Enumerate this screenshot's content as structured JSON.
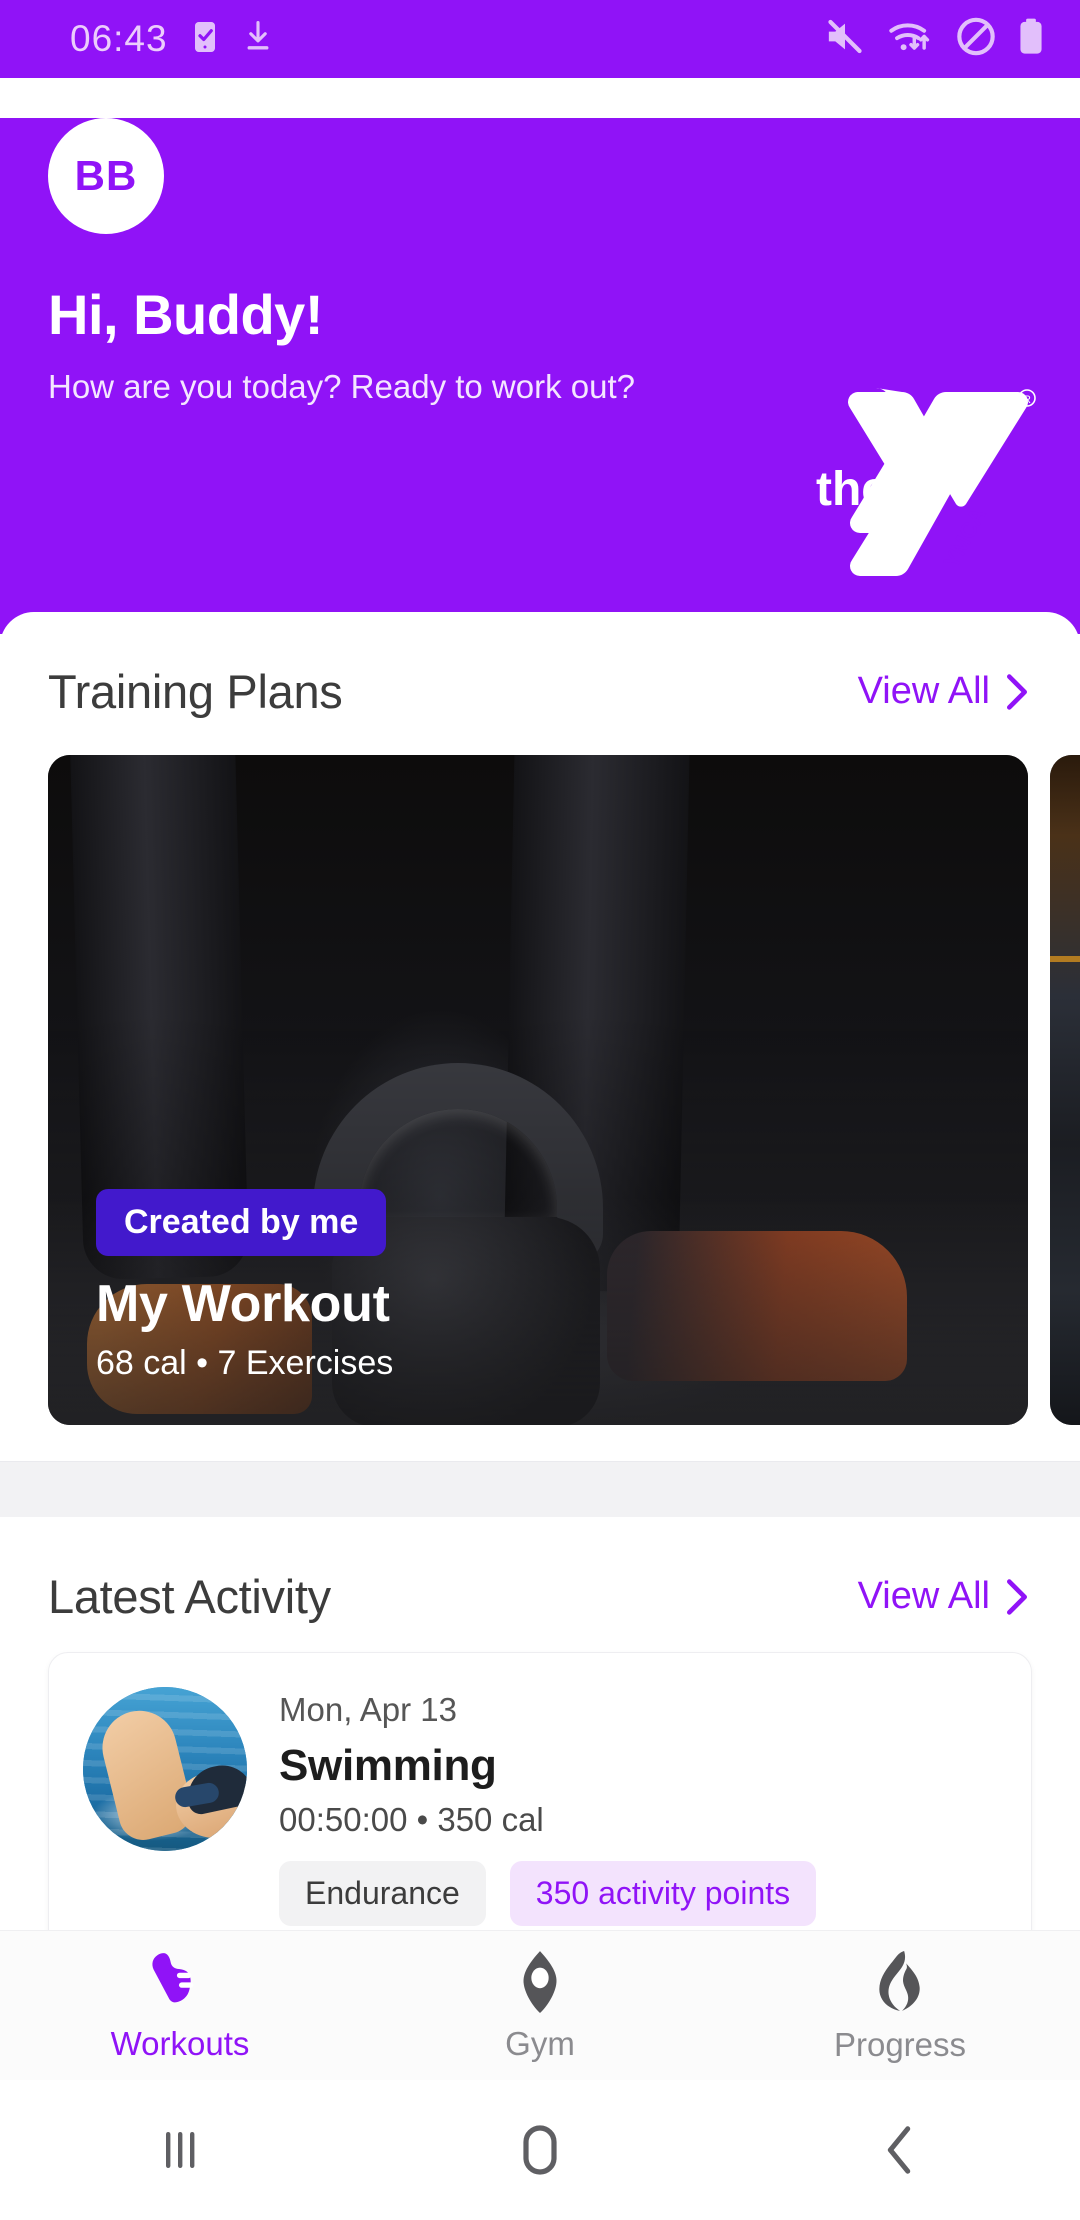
{
  "status_bar": {
    "time": "06:43",
    "left_icons": [
      "sim-card-check-icon",
      "download-icon"
    ],
    "right_icons": [
      "mute-icon",
      "wifi-transfer-icon",
      "do-not-disturb-icon",
      "battery-icon"
    ]
  },
  "header": {
    "avatar_initials": "BB",
    "greeting": "Hi, Buddy!",
    "subtitle": "How are you today? Ready to work out?",
    "logo": {
      "the_text": "the",
      "ymca_text": "YMCA",
      "registered_mark": "®"
    },
    "background_color": "#9013f7"
  },
  "training_plans": {
    "section_title": "Training Plans",
    "view_all_label": "View All",
    "cards": [
      {
        "badge": "Created by me",
        "title": "My Workout",
        "meta": "68 cal • 7 Exercises",
        "badge_color": "#4219cc",
        "image": "kettlebell-photo"
      },
      {
        "image": "gym-photo"
      }
    ]
  },
  "latest_activity": {
    "section_title": "Latest Activity",
    "view_all_label": "View All",
    "items": [
      {
        "date": "Mon, Apr 13",
        "title": "Swimming",
        "meta": "00:50:00 • 350 cal",
        "thumbnail": "swimming-photo",
        "tags": [
          {
            "label": "Endurance",
            "style": "grey"
          },
          {
            "label": "350 activity points",
            "style": "purple"
          }
        ]
      }
    ]
  },
  "bottom_nav": {
    "items": [
      {
        "label": "Workouts",
        "icon": "shoe-icon",
        "active": true
      },
      {
        "label": "Gym",
        "icon": "location-pin-icon",
        "active": false
      },
      {
        "label": "Progress",
        "icon": "flame-icon",
        "active": false
      }
    ],
    "active_color": "#9013f7",
    "idle_color": "#8b8b8f"
  },
  "android_nav": {
    "items": [
      "recents-icon",
      "home-icon",
      "back-icon"
    ]
  }
}
